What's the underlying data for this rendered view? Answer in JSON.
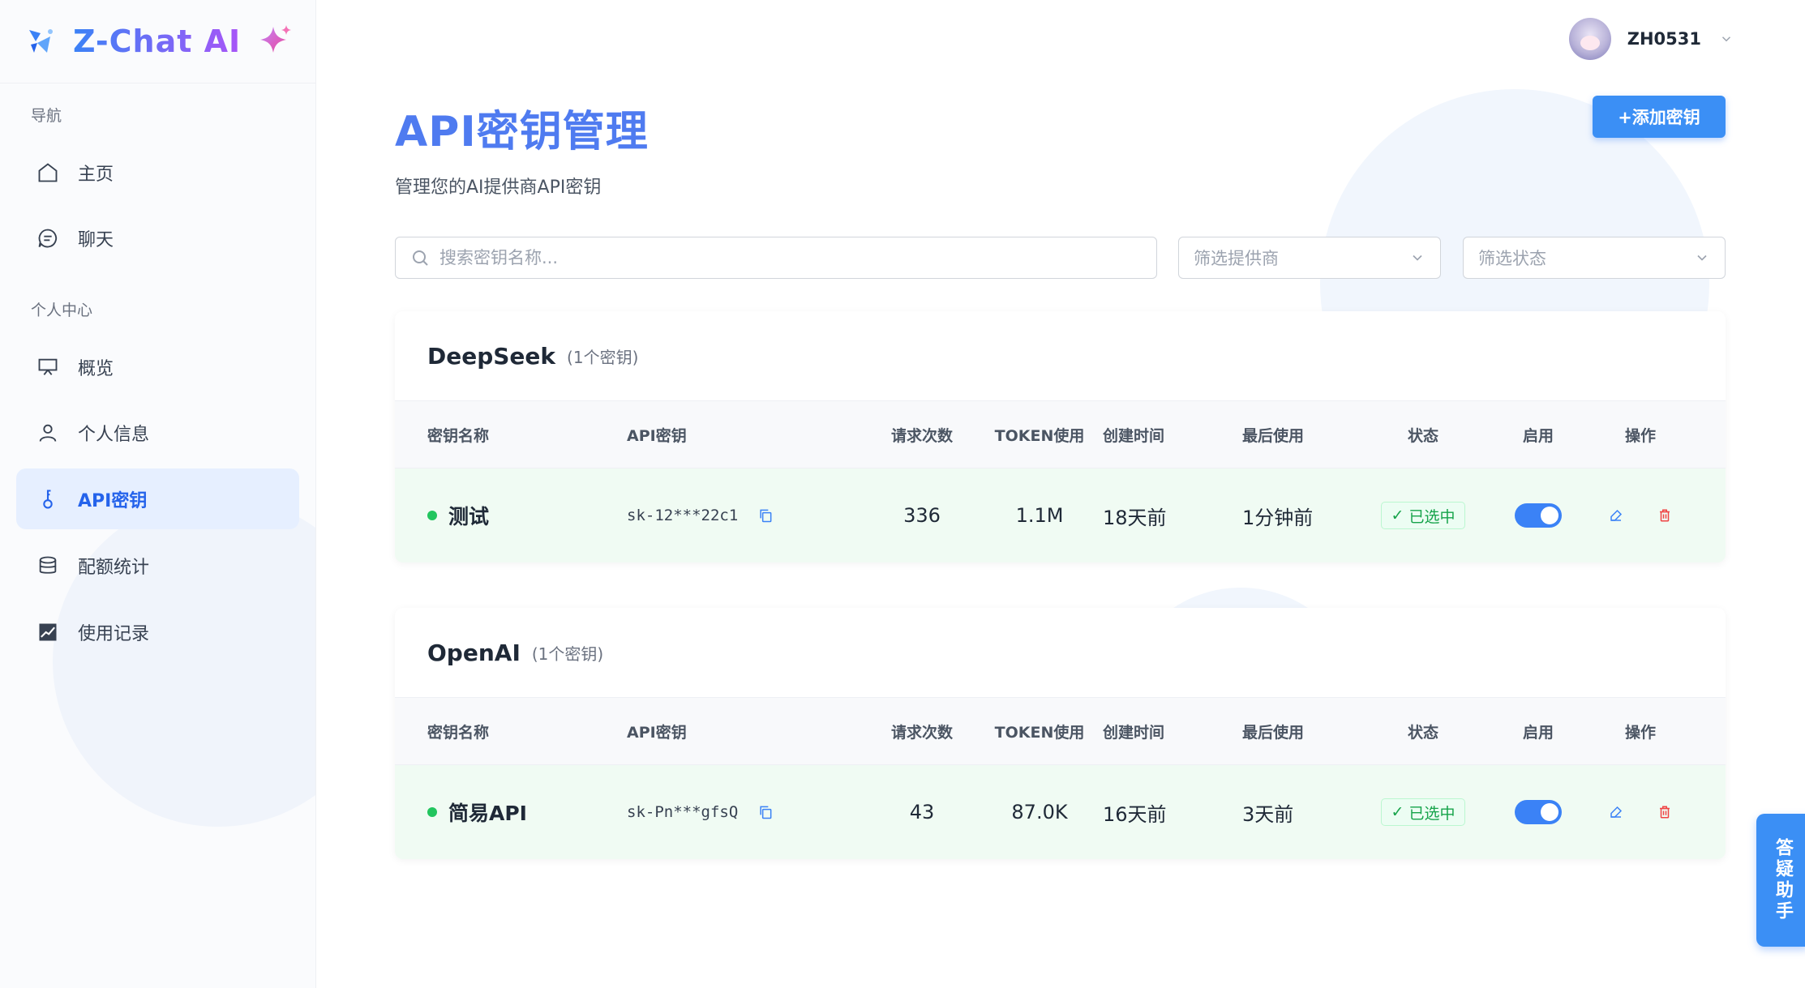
{
  "app": {
    "name": "Z-Chat AI"
  },
  "sidebar": {
    "sections": [
      {
        "title": "导航"
      },
      {
        "title": "个人中心"
      }
    ],
    "items": [
      {
        "label": "主页",
        "icon": "home-icon",
        "active": false
      },
      {
        "label": "聊天",
        "icon": "chat-icon",
        "active": false
      },
      {
        "label": "概览",
        "icon": "presentation-icon",
        "active": false
      },
      {
        "label": "个人信息",
        "icon": "user-icon",
        "active": false
      },
      {
        "label": "API密钥",
        "icon": "key-icon",
        "active": true
      },
      {
        "label": "配额统计",
        "icon": "database-icon",
        "active": false
      },
      {
        "label": "使用记录",
        "icon": "chart-icon",
        "active": false
      }
    ]
  },
  "header": {
    "username": "ZH0531"
  },
  "page": {
    "title": "API密钥管理",
    "subtitle": "管理您的AI提供商API密钥",
    "add_button": "+添加密钥"
  },
  "filters": {
    "search_placeholder": "搜索密钥名称...",
    "provider_placeholder": "筛选提供商",
    "status_placeholder": "筛选状态"
  },
  "columns": [
    "密钥名称",
    "API密钥",
    "请求次数",
    "TOKEN使用",
    "创建时间",
    "最后使用",
    "状态",
    "启用",
    "操作"
  ],
  "groups": [
    {
      "name": "DeepSeek",
      "count": "(1个密钥)",
      "rows": [
        {
          "name": "测试",
          "key": "sk-12***22c1",
          "requests": "336",
          "tokens": "1.1M",
          "created": "18天前",
          "last_used": "1分钟前",
          "status": "已选中",
          "enabled": true
        }
      ]
    },
    {
      "name": "OpenAI",
      "count": "(1个密钥)",
      "rows": [
        {
          "name": "简易API",
          "key": "sk-Pn***gfsQ",
          "requests": "43",
          "tokens": "87.0K",
          "created": "16天前",
          "last_used": "3天前",
          "status": "已选中",
          "enabled": true
        }
      ]
    }
  ],
  "helper": {
    "label": "答疑助手"
  },
  "colors": {
    "accent": "#3b8ff5",
    "title": "#4f7bf0",
    "success": "#22c55e",
    "danger": "#ef4444"
  }
}
